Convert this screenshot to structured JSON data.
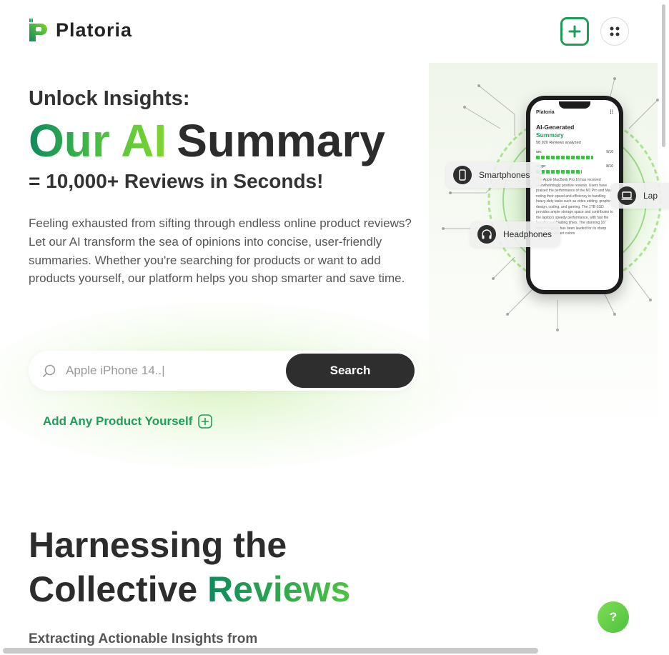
{
  "brand": {
    "name": "Platoria",
    "accent": "#1e9e5a",
    "accent_light": "#7fd62d"
  },
  "header": {
    "add_icon": "plus-square-icon",
    "menu_icon": "grid-dots-icon"
  },
  "hero": {
    "pre": "Unlock Insights:",
    "highlight": "Our AI",
    "main": "Summary",
    "sub": "= 10,000+ Reviews in Seconds!",
    "description": "Feeling exhausted from sifting through endless online product reviews? Let our AI transform the sea of opinions into concise, user-friendly summaries. Whether you're searching for products or want to add products yourself, our platform helps you shop smarter and save time."
  },
  "search": {
    "value": "Apple iPhone 14..|",
    "button_label": "Search",
    "icon": "search-icon"
  },
  "add_product": {
    "label": "Add Any Product Yourself",
    "icon": "plus-square-icon"
  },
  "illustration": {
    "phone_logo": "Platoria",
    "phone_title": "AI-Generated",
    "phone_title2": "Summary",
    "phone_count": "58 920 Reviews analyzed",
    "rows": [
      {
        "label": "am:",
        "score": "9/10"
      },
      {
        "label": "orage:",
        "score": "8/10"
      }
    ],
    "phone_text": "The Apple MacBook Pro 16 has received overwhelmingly positive reviews. Users have praised the performance of the M1 Pro and Max, noting their speed and efficiency in handling heavy-duty tasks such as video editing, graphic design, coding, and gaming. The 1TB SSD provides ample storage space and contributes to the laptop's speedy performance, with fast file transfer and loading times. The stunning 16\" Retina Display has been lauded for its sharp resolution, vibrant colors",
    "chips": [
      {
        "label": "Smartphones",
        "icon": "smartphone-icon"
      },
      {
        "label": "Headphones",
        "icon": "headphones-icon"
      },
      {
        "label": "Lap",
        "icon": "laptop-icon"
      }
    ]
  },
  "section2": {
    "title_line1": "Harnessing the",
    "title_line2": "Collective",
    "title_accent": "Reviews",
    "subtitle": "Extracting Actionable Insights from"
  },
  "help": {
    "label": "?"
  }
}
